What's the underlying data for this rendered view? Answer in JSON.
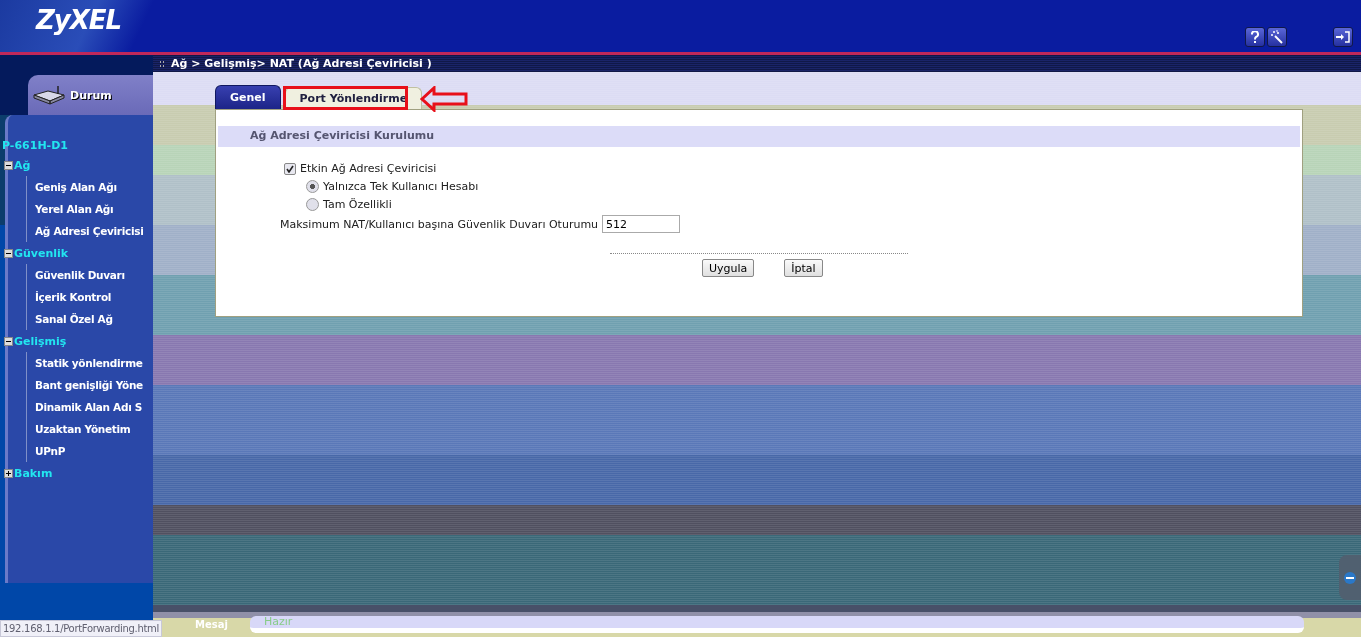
{
  "header": {
    "logo": "ZyXEL",
    "tools": [
      {
        "kind": "help"
      },
      {
        "kind": "wizard"
      },
      {
        "kind": "logout"
      }
    ]
  },
  "sidebar": {
    "status_tab": "Durum",
    "device": "P-661H-D1",
    "tree": [
      {
        "label": "Ağ",
        "expanded": true,
        "children": [
          {
            "label": "Geniş Alan Ağı"
          },
          {
            "label": "Yerel Alan Ağı"
          },
          {
            "label": "Ağ Adresi Çeviricisi"
          }
        ]
      },
      {
        "label": "Güvenlik",
        "expanded": true,
        "children": [
          {
            "label": "Güvenlik Duvarı"
          },
          {
            "label": "İçerik Kontrol"
          },
          {
            "label": "Sanal Özel Ağ"
          }
        ]
      },
      {
        "label": "Gelişmiş",
        "expanded": true,
        "children": [
          {
            "label": "Statik yönlendirme"
          },
          {
            "label": "Bant genişliği Yöne"
          },
          {
            "label": "Dinamik Alan Adı S"
          },
          {
            "label": "Uzaktan Yönetim"
          },
          {
            "label": "UPnP"
          }
        ]
      },
      {
        "label": "Bakım",
        "expanded": false
      }
    ]
  },
  "breadcrumb": "Ağ > Gelişmiş> NAT (Ağ Adresi Çeviricisi )",
  "tabs": [
    {
      "label": "Genel",
      "selected": true
    },
    {
      "label": "Port Yönlendirme",
      "selected": false
    }
  ],
  "section_title": "Ağ Adresi Çeviricisi Kurulumu",
  "nat_enabled": {
    "label": "Etkin Ağ Adresi Çeviricisi",
    "checked": true
  },
  "modes": [
    {
      "label": "Yalnızca Tek Kullanıcı Hesabı",
      "selected": true
    },
    {
      "label": "Tam Özellikli",
      "selected": false
    }
  ],
  "sessions": {
    "label": "Maksimum NAT/Kullanıcı başına Güvenlik Duvarı Oturumu",
    "value": "512"
  },
  "buttons": [
    "Uygula",
    "İptal"
  ],
  "status_bar": {
    "label": "Mesaj",
    "message": "Hazır"
  },
  "url_tooltip": "192.168.1.1/PortForwarding.html"
}
